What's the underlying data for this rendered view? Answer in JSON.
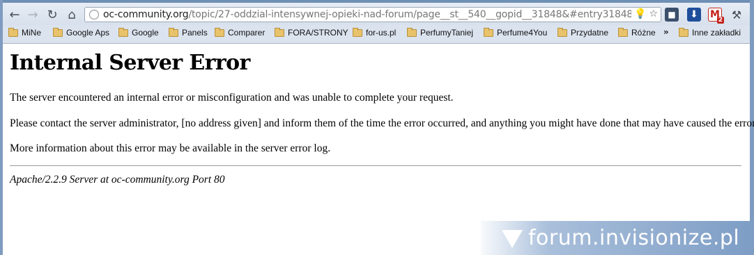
{
  "browser": {
    "url_host": "oc-community.org",
    "url_path": "/topic/27-oddzial-intensywnej-opieki-nad-forum/page__st__540__gopid__31848&#entry31848",
    "extensions": [
      {
        "name": "camera-extension",
        "label": "■"
      },
      {
        "name": "download-extension",
        "label": "⬇"
      },
      {
        "name": "gmail-extension",
        "label": "M",
        "badge": "2"
      },
      {
        "name": "settings-wrench",
        "label": "⚒"
      }
    ]
  },
  "bookmarks": {
    "items": [
      {
        "label": "MiNe"
      },
      {
        "label": "Google Aps"
      },
      {
        "label": "Google"
      },
      {
        "label": "Panels"
      },
      {
        "label": "Comparer"
      },
      {
        "label": "FORA/STRONY"
      },
      {
        "label": "for-us.pl"
      },
      {
        "label": "PerfumyTaniej"
      },
      {
        "label": "Perfume4You"
      },
      {
        "label": "Przydatne"
      },
      {
        "label": "Różne"
      }
    ],
    "overflow": "»",
    "other": "Inne zakładki"
  },
  "page": {
    "title": "Internal Server Error",
    "p1": "The server encountered an internal error or misconfiguration and was unable to complete your request.",
    "p2": "Please contact the server administrator, [no address given] and inform them of the time the error occurred, and anything you might have done that may have caused the error.",
    "p3": "More information about this error may be available in the server error log.",
    "signature": "Apache/2.2.9 Server at oc-community.org Port 80"
  },
  "watermark": {
    "text": "forum.invisionize.pl"
  }
}
